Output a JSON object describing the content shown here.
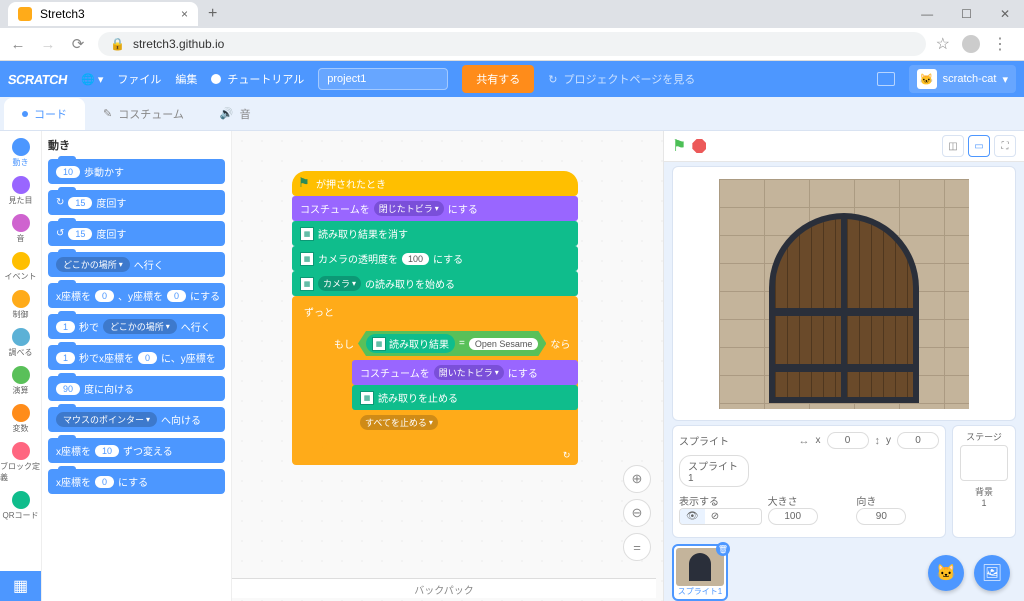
{
  "browser": {
    "tab_title": "Stretch3",
    "url": "stretch3.github.io"
  },
  "menu": {
    "file": "ファイル",
    "edit": "編集",
    "tutorial": "チュートリアル",
    "project_name": "project1",
    "share": "共有する",
    "community": "プロジェクトページを見る",
    "username": "scratch-cat"
  },
  "tabs": {
    "code": "コード",
    "costumes": "コスチューム",
    "sounds": "音"
  },
  "categories": [
    {
      "name": "動き",
      "color": "#4c97ff"
    },
    {
      "name": "見た目",
      "color": "#9966ff"
    },
    {
      "name": "音",
      "color": "#cf63cf"
    },
    {
      "name": "イベント",
      "color": "#ffbf00"
    },
    {
      "name": "制御",
      "color": "#ffab19"
    },
    {
      "name": "調べる",
      "color": "#5cb1d6"
    },
    {
      "name": "演算",
      "color": "#59c059"
    },
    {
      "name": "変数",
      "color": "#ff8c1a"
    },
    {
      "name": "ブロック定義",
      "color": "#ff6680"
    },
    {
      "name": "QRコード",
      "color": "#0fbd8c"
    }
  ],
  "palette": {
    "title": "動き",
    "move_steps": {
      "label": "歩動かす",
      "val": "10"
    },
    "turn_cw": {
      "label": "度回す",
      "val": "15"
    },
    "turn_ccw": {
      "label": "度回す",
      "val": "15"
    },
    "goto": {
      "prefix": "",
      "dd": "どこかの場所",
      "suffix": "へ行く"
    },
    "goto_xy": {
      "p1": "x座標を",
      "v1": "0",
      "p2": "、y座標を",
      "v2": "0",
      "p3": "にする"
    },
    "glide": {
      "v1": "1",
      "p1": "秒で",
      "dd": "どこかの場所",
      "p2": "へ行く"
    },
    "glide_xy": {
      "v1": "1",
      "p1": "秒でx座標を",
      "v2": "0",
      "p2": "に、y座標を"
    },
    "point_dir": {
      "v": "90",
      "label": "度に向ける"
    },
    "point_to": {
      "dd": "マウスのポインター",
      "label": "へ向ける"
    },
    "change_x": {
      "p1": "x座標を",
      "v": "10",
      "p2": "ずつ変える"
    },
    "set_x": {
      "p1": "x座標を",
      "v": "0",
      "p2": "にする"
    }
  },
  "script": {
    "hat": "が押されたとき",
    "switch_costume": {
      "p1": "コスチュームを",
      "dd": "閉じたトビラ",
      "p2": "にする"
    },
    "clear_result": "読み取り結果を消す",
    "camera_trans": {
      "p1": "カメラの透明度を",
      "v": "100",
      "p2": "にする"
    },
    "start_read": {
      "dd": "カメラ",
      "label": "の読み取りを始める"
    },
    "forever": "ずっと",
    "if": "もし",
    "then": "なら",
    "read_result": "読み取り結果",
    "sesame": "Open Sesame",
    "switch_open": {
      "p1": "コスチュームを",
      "dd": "開いたトビラ",
      "p2": "にする"
    },
    "stop_read": "読み取りを止める",
    "stop_all": {
      "dd": "すべてを止める"
    }
  },
  "sprite_info": {
    "sprite_label": "スプライト",
    "sprite_name": "スプライト1",
    "x_label": "x",
    "x_val": "0",
    "y_label": "y",
    "y_val": "0",
    "show_label": "表示する",
    "size_label": "大きさ",
    "size_val": "100",
    "dir_label": "向き",
    "dir_val": "90"
  },
  "stage_panel": {
    "title": "ステージ",
    "backdrop_label": "背景",
    "backdrop_count": "1"
  },
  "thumb_name": "スプライト1",
  "backpack": "バックパック"
}
